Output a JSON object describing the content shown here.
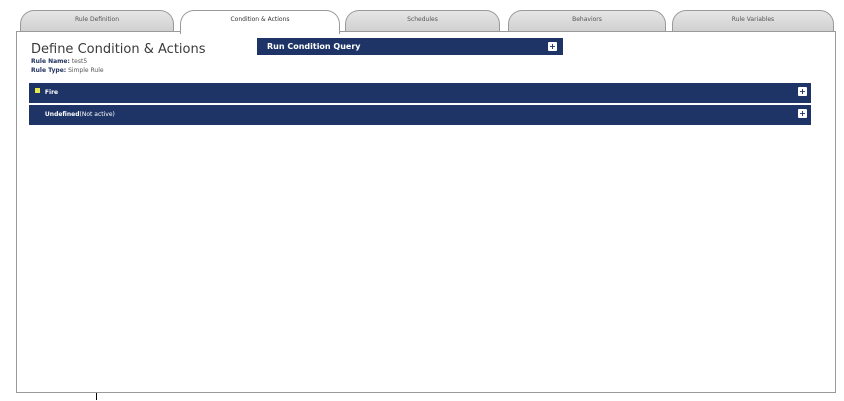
{
  "tabs": [
    {
      "label": "Rule Definition",
      "active": false
    },
    {
      "label": "Condition & Actions",
      "active": true
    },
    {
      "label": "Schedules",
      "active": false
    },
    {
      "label": "Behaviors",
      "active": false
    },
    {
      "label": "Rule Variables",
      "active": false
    }
  ],
  "page": {
    "title": "Define Condition & Actions",
    "rule_name_label": "Rule Name:",
    "rule_name_value": "test5",
    "rule_type_label": "Rule Type:",
    "rule_type_value": "Simple Rule"
  },
  "query_bar": {
    "label": "Run Condition Query",
    "toggle": "+"
  },
  "rows": [
    {
      "title": "Fire",
      "subtitle": "",
      "bullet_color": "#e8e84a",
      "toggle": "+"
    },
    {
      "title": "Undefined",
      "subtitle": "(Not active)",
      "bullet_color": "#1e3466",
      "toggle": "+"
    }
  ],
  "colors": {
    "bar_bg": "#1e3466",
    "tab_bg": "#d9d9d9",
    "border": "#9a9a9a"
  }
}
